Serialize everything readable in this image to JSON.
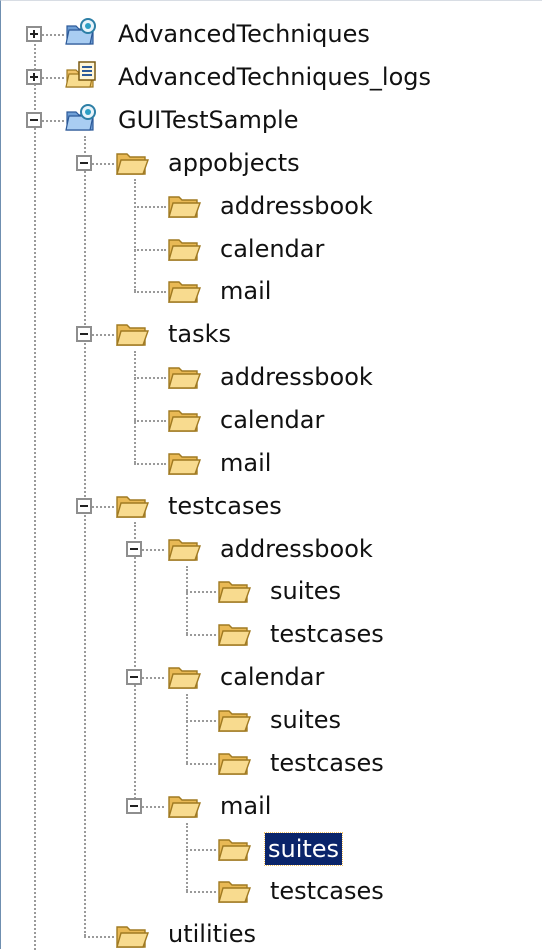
{
  "tree": {
    "selected_color": "#0a246a",
    "folder_color": "#f2c469",
    "nodes": [
      {
        "label": "AdvancedTechniques",
        "icon": "project-icon",
        "expanded": false,
        "selected": false
      },
      {
        "label": "AdvancedTechniques_logs",
        "icon": "log-project-icon",
        "expanded": false,
        "selected": false
      },
      {
        "label": "GUITestSample",
        "icon": "project-icon",
        "expanded": true,
        "selected": false
      },
      {
        "label": "appobjects",
        "icon": "folder-open-icon",
        "expanded": true,
        "selected": false
      },
      {
        "label": "addressbook",
        "icon": "folder-open-icon",
        "selected": false
      },
      {
        "label": "calendar",
        "icon": "folder-open-icon",
        "selected": false
      },
      {
        "label": "mail",
        "icon": "folder-open-icon",
        "selected": false
      },
      {
        "label": "tasks",
        "icon": "folder-open-icon",
        "expanded": true,
        "selected": false
      },
      {
        "label": "addressbook",
        "icon": "folder-open-icon",
        "selected": false
      },
      {
        "label": "calendar",
        "icon": "folder-open-icon",
        "selected": false
      },
      {
        "label": "mail",
        "icon": "folder-open-icon",
        "selected": false
      },
      {
        "label": "testcases",
        "icon": "folder-open-icon",
        "expanded": true,
        "selected": false
      },
      {
        "label": "addressbook",
        "icon": "folder-open-icon",
        "expanded": true,
        "selected": false
      },
      {
        "label": "suites",
        "icon": "folder-open-icon",
        "selected": false
      },
      {
        "label": "testcases",
        "icon": "folder-open-icon",
        "selected": false
      },
      {
        "label": "calendar",
        "icon": "folder-open-icon",
        "expanded": true,
        "selected": false
      },
      {
        "label": "suites",
        "icon": "folder-open-icon",
        "selected": false
      },
      {
        "label": "testcases",
        "icon": "folder-open-icon",
        "selected": false
      },
      {
        "label": "mail",
        "icon": "folder-open-icon",
        "expanded": true,
        "selected": false
      },
      {
        "label": "suites",
        "icon": "folder-open-icon",
        "selected": true
      },
      {
        "label": "testcases",
        "icon": "folder-open-icon",
        "selected": false
      },
      {
        "label": "utilities",
        "icon": "folder-open-icon",
        "selected": false
      }
    ]
  }
}
